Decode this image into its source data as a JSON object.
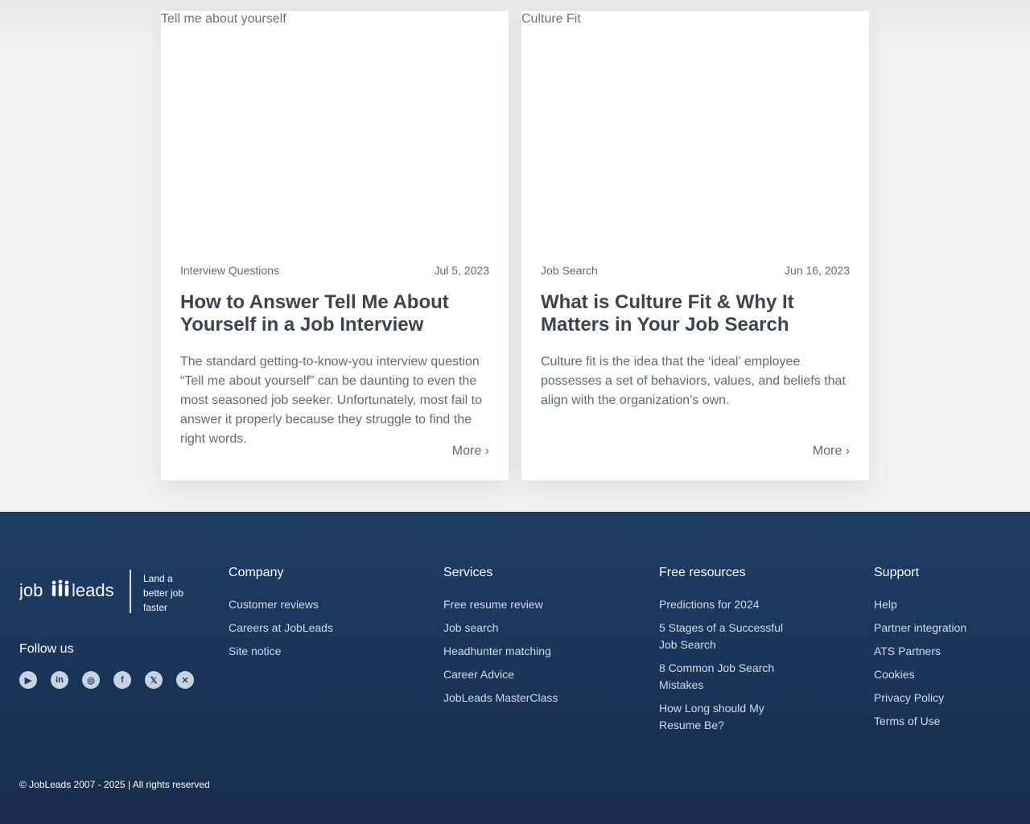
{
  "cards": [
    {
      "image_alt": "Tell me about yourself",
      "category": "Interview Questions",
      "date": "Jul 5, 2023",
      "title": "How to Answer Tell Me About Yourself in a Job Interview",
      "excerpt": "The standard getting-to-know-you interview question “Tell me about yourself” can be daunting to even the most seasoned job seeker. Unfortunately, most fail to answer it properly because they struggle to find the right words.",
      "more_label": "More ›"
    },
    {
      "image_alt": "Culture Fit",
      "category": "Job Search",
      "date": "Jun 16, 2023",
      "title": "What is Culture Fit & Why It Matters in Your Job Search",
      "excerpt": "Culture fit is the idea that the ‘ideal’ employee possesses a set of behaviors, values, and beliefs that align with the organization’s own.",
      "more_label": "More ›"
    }
  ],
  "footer": {
    "brand": {
      "logo_text": "jobleads",
      "tagline": "Land a better job faster"
    },
    "follow_label": "Follow us",
    "socials": [
      {
        "icon": "youtube-icon",
        "glyph": "▶"
      },
      {
        "icon": "linkedin-icon",
        "glyph": "in"
      },
      {
        "icon": "instagram-icon",
        "glyph": "◎"
      },
      {
        "icon": "facebook-icon",
        "glyph": "f"
      },
      {
        "icon": "x-icon",
        "glyph": "𝕏"
      },
      {
        "icon": "xing-icon",
        "glyph": "✕"
      }
    ],
    "columns": [
      {
        "heading": "Company",
        "links": [
          "Customer reviews",
          "Careers at JobLeads",
          "Site notice"
        ]
      },
      {
        "heading": "Services",
        "links": [
          "Free resume review",
          "Job search",
          "Headhunter matching",
          "Career Advice",
          "JobLeads MasterClass"
        ]
      },
      {
        "heading": "Free resources",
        "links": [
          "Predictions for 2024",
          "5 Stages of a Successful Job Search",
          "8 Common Job Search Mistakes",
          "How Long should My Resume Be?"
        ]
      },
      {
        "heading": "Support",
        "links": [
          "Help",
          "Partner integration",
          "ATS Partners",
          "Cookies",
          "Privacy Policy",
          "Terms of Use"
        ]
      }
    ],
    "copyright": "© JobLeads 2007 - 2025 | All rights reserved"
  },
  "colors": {
    "footer_top": "#1e3d66",
    "footer_bottom": "#172d4b",
    "text_dark": "#3b4452",
    "text_muted": "#5f6b7a"
  }
}
